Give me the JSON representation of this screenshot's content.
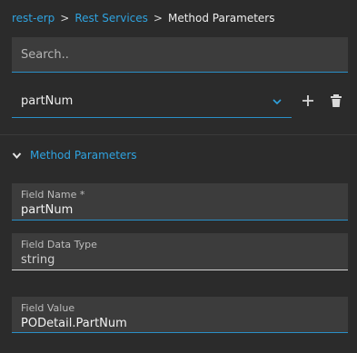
{
  "breadcrumb": {
    "items": [
      "rest-erp",
      "Rest Services"
    ],
    "separator": ">",
    "current": "Method Parameters"
  },
  "search": {
    "placeholder": "Search.."
  },
  "selector": {
    "value": "partNum",
    "dropdown_icon": "chevron-down-icon",
    "add_icon": "plus-icon",
    "delete_icon": "trash-icon"
  },
  "section": {
    "title": "Method Parameters",
    "expanded": true
  },
  "fields": {
    "field_name": {
      "label": "Field Name *",
      "value": "partNum"
    },
    "field_data_type": {
      "label": "Field Data Type",
      "value": "string"
    },
    "field_value": {
      "label": "Field Value",
      "value": "PODetail.PartNum"
    }
  },
  "colors": {
    "background": "#2b2b2b",
    "field_background": "#3c3c3c",
    "accent": "#2fa3e0"
  }
}
